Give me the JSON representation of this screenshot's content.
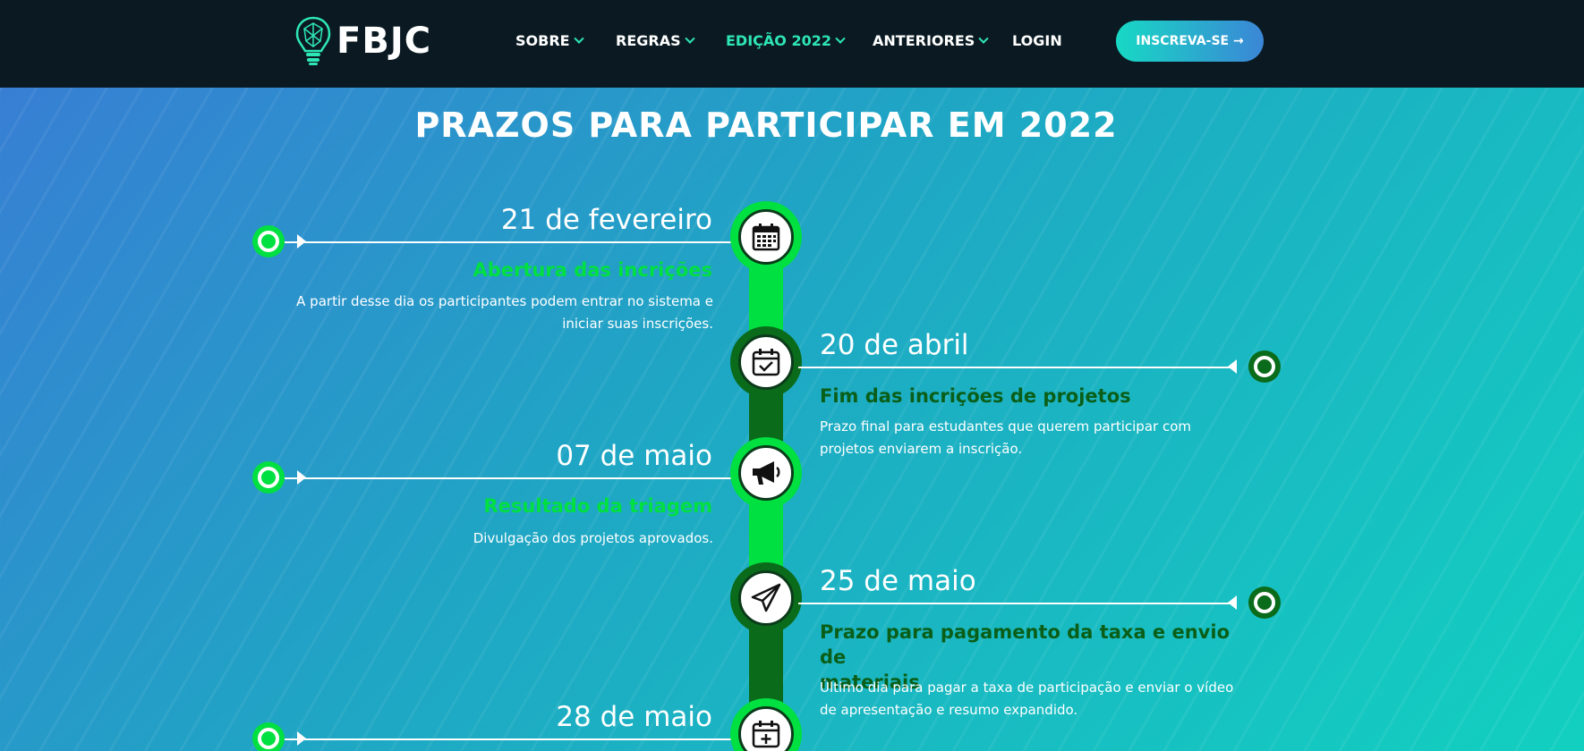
{
  "header": {
    "logo_text": "FBJC",
    "nav": [
      {
        "label": "SOBRE",
        "active": false
      },
      {
        "label": "REGRAS",
        "active": false
      },
      {
        "label": "EDIÇÃO 2022",
        "active": true
      },
      {
        "label": "ANTERIORES",
        "active": false
      },
      {
        "label": "LOGIN",
        "active": false
      }
    ],
    "cta_label": "INSCREVA-SE →"
  },
  "page_title": "PRAZOS PARA PARTICIPAR EM 2022",
  "colors": {
    "header_bg": "#0b1a22",
    "accent_green": "#00e040",
    "dark_green": "#0a6b1a",
    "nav_active": "#2ee6b5"
  },
  "timeline": [
    {
      "date": "21 de fevereiro",
      "title": "Abertura das incrições",
      "description_lines": [
        "A partir desse dia os participantes podem entrar no sistema e",
        "iniciar suas inscrições."
      ],
      "icon": "calendar-icon",
      "side": "left"
    },
    {
      "date": "20 de abril",
      "title": "Fim das incrições de projetos",
      "description_lines": [
        "Prazo final para estudantes que querem participar com",
        "projetos enviarem a inscrição."
      ],
      "icon": "calendar-check-icon",
      "side": "right"
    },
    {
      "date": "07 de maio",
      "title": "Resultado da triagem",
      "description_lines": [
        "Divulgação dos projetos aprovados."
      ],
      "icon": "megaphone-icon",
      "side": "left"
    },
    {
      "date": "25 de maio",
      "title_lines": [
        "Prazo para pagamento da taxa e envio de",
        "materiais"
      ],
      "description_lines": [
        "Último dia para pagar a taxa de participação e enviar o vídeo",
        "de apresentação e resumo expandido."
      ],
      "icon": "paper-plane-icon",
      "side": "right"
    },
    {
      "date": "28 de maio",
      "icon": "calendar-plus-icon",
      "side": "left"
    }
  ]
}
